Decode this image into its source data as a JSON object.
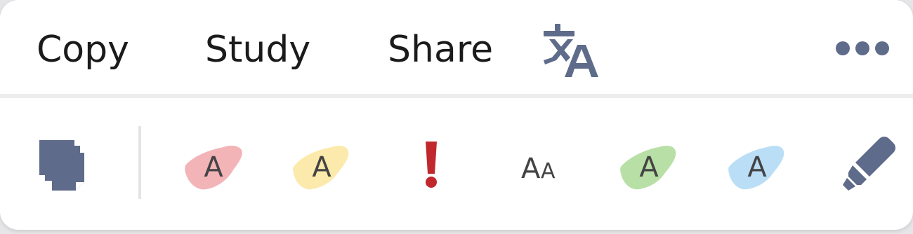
{
  "menu": {
    "items": [
      {
        "label": "Copy"
      },
      {
        "label": "Study"
      },
      {
        "label": "Share"
      }
    ],
    "translate_icon": "translate-icon",
    "more_icon": "more-horizontal-icon"
  },
  "toolbar": {
    "tools": [
      {
        "icon": "copy-pages-icon"
      },
      {
        "icon": "highlight-red-icon",
        "glyph": "A",
        "color": "#f1a7ab"
      },
      {
        "icon": "highlight-yellow-icon",
        "glyph": "A",
        "color": "#fbe9a6"
      },
      {
        "icon": "important-mark-icon",
        "glyph": "!",
        "color": "#c0282d"
      },
      {
        "icon": "text-size-icon",
        "glyph": "AA"
      },
      {
        "icon": "highlight-green-icon",
        "glyph": "A",
        "color": "#b4dda0"
      },
      {
        "icon": "highlight-blue-icon",
        "glyph": "A",
        "color": "#b6dcf6"
      },
      {
        "icon": "highlighter-pen-icon"
      }
    ]
  },
  "colors": {
    "icon_slate": "#5f6b8a",
    "text_dark": "#1b1b1b",
    "glyph_gray": "#444444"
  }
}
